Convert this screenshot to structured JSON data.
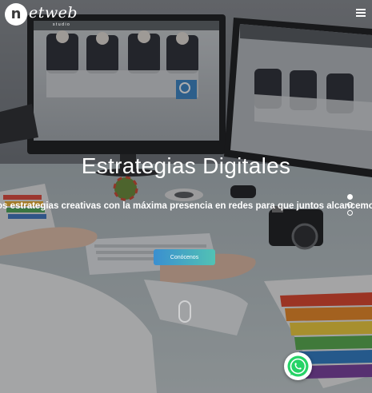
{
  "brand": {
    "badge_letter": "n",
    "wordmark": "etweb",
    "subtitle": "studio"
  },
  "header": {
    "menu_icon": "hamburger-icon"
  },
  "hero": {
    "title": "Estrategias Digitales",
    "subtitle": "os estrategias creativas con la máxima presencia en redes para que juntos alcancemos t",
    "cta_label": "Conócenos",
    "slides": 3,
    "active_slide": 1,
    "scroll_icon": "mouse-scroll-icon"
  },
  "whatsapp": {
    "icon": "whatsapp-icon"
  },
  "colors": {
    "cta_start": "#3a8fd0",
    "cta_end": "#52c2b4",
    "whatsapp": "#25d366"
  }
}
